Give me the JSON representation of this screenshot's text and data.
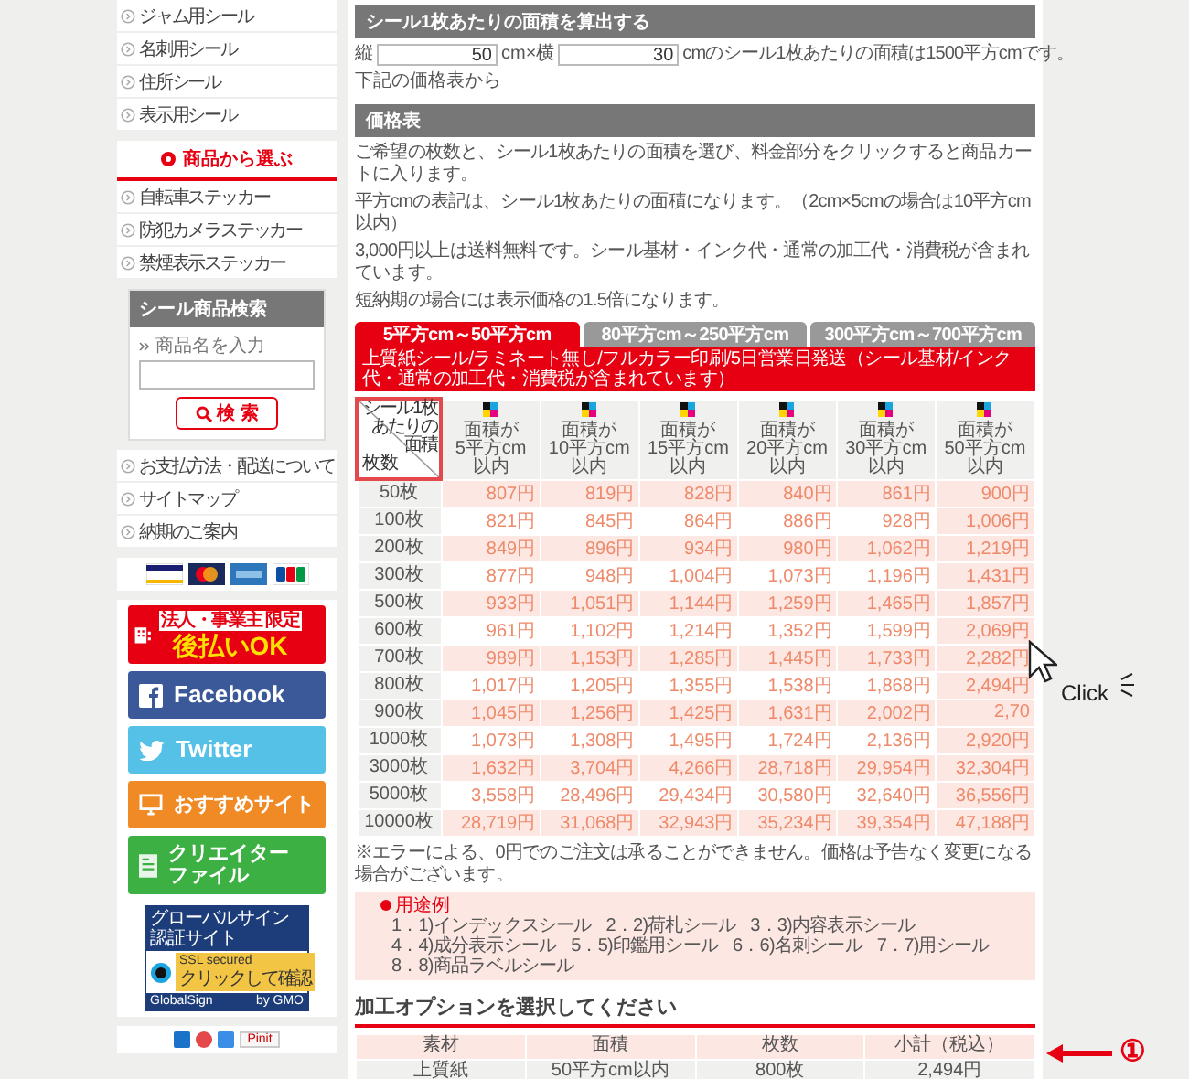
{
  "sidebar": {
    "top_items": [
      "ジャム用シール",
      "名刺用シール",
      "住所シール",
      "表示用シール"
    ],
    "category": {
      "title": "商品から選ぶ",
      "items": [
        "自転車ステッカー",
        "防犯カメラステッカー",
        "禁煙表示ステッカー"
      ]
    },
    "search": {
      "title": "シール商品検索",
      "hint": "商品名を入力",
      "button": "検 索"
    },
    "info_items": [
      "お支払方法・配送について",
      "サイトマップ",
      "納期のご案内"
    ],
    "banners": [
      {
        "kind": "atobarai",
        "tag": "法人・事業主 限定",
        "label": "後払いOK"
      },
      {
        "kind": "facebook",
        "label": "Facebook"
      },
      {
        "kind": "twitter",
        "label": "Twitter"
      },
      {
        "kind": "recommend",
        "label": "おすすめサイト"
      },
      {
        "kind": "creator",
        "lines": [
          "クリエイター",
          "ファイル"
        ]
      }
    ],
    "seal": {
      "title": "グローバルサイン認証サイト",
      "ssl": "SSL secured",
      "check": "クリックして確認",
      "brand": "GlobalSign",
      "by": "by GMO"
    },
    "share": {
      "pin": "Pinit"
    }
  },
  "calculator": {
    "title": "シール1枚あたりの面積を算出する",
    "height_label": "縦",
    "height_value": "50",
    "times_label": "cm×横",
    "width_value": "30",
    "result": "cmのシール1枚あたりの面積は1500平方cmです。",
    "next": "下記の価格表から"
  },
  "price_table": {
    "title": "価格表",
    "notes": [
      "ご希望の枚数と、シール1枚あたりの面積を選び、料金部分をクリックすると商品カートに入ります。",
      "平方cmの表記は、シール1枚あたりの面積になります。（2cm×5cmの場合は10平方cm以内）",
      "3,000円以上は送料無料です。シール基材・インク代・通常の加工代・消費税が含まれています。",
      "短納期の場合には表示価格の1.5倍になります。"
    ],
    "tabs": [
      {
        "label": "5平方cm～50平方cm",
        "selected": true
      },
      {
        "label": "80平方cm～250平方cm",
        "selected": false
      },
      {
        "label": "300平方cm～700平方cm",
        "selected": false
      }
    ],
    "banner": "上質紙シール/ラミネート無し/フルカラー印刷/5日営業日発送（シール基材/インク代・通常の加工代・消費税が含まれています）",
    "corner": {
      "area": "シール1枚あたりの面積",
      "qty": "枚数"
    },
    "columns": [
      {
        "lines": [
          "面積が",
          "5平方cm",
          "以内"
        ],
        "highlighted": false
      },
      {
        "lines": [
          "面積が",
          "10平方cm",
          "以内"
        ],
        "highlighted": false
      },
      {
        "lines": [
          "面積が",
          "15平方cm",
          "以内"
        ],
        "highlighted": false
      },
      {
        "lines": [
          "面積が",
          "20平方cm",
          "以内"
        ],
        "highlighted": false
      },
      {
        "lines": [
          "面積が",
          "30平方cm",
          "以内"
        ],
        "highlighted": false
      },
      {
        "lines": [
          "面積が",
          "50平方cm",
          "以内"
        ],
        "highlighted": true
      }
    ],
    "rows": [
      {
        "qty": "50枚",
        "prices": [
          "807円",
          "819円",
          "828円",
          "840円",
          "861円",
          "900円"
        ]
      },
      {
        "qty": "100枚",
        "prices": [
          "821円",
          "845円",
          "864円",
          "886円",
          "928円",
          "1,006円"
        ]
      },
      {
        "qty": "200枚",
        "prices": [
          "849円",
          "896円",
          "934円",
          "980円",
          "1,062円",
          "1,219円"
        ]
      },
      {
        "qty": "300枚",
        "prices": [
          "877円",
          "948円",
          "1,004円",
          "1,073円",
          "1,196円",
          "1,431円"
        ]
      },
      {
        "qty": "500枚",
        "prices": [
          "933円",
          "1,051円",
          "1,144円",
          "1,259円",
          "1,465円",
          "1,857円"
        ]
      },
      {
        "qty": "600枚",
        "prices": [
          "961円",
          "1,102円",
          "1,214円",
          "1,352円",
          "1,599円",
          "2,069円"
        ]
      },
      {
        "qty": "700枚",
        "prices": [
          "989円",
          "1,153円",
          "1,285円",
          "1,445円",
          "1,733円",
          "2,282円"
        ]
      },
      {
        "qty": "800枚",
        "prices": [
          "1,017円",
          "1,205円",
          "1,355円",
          "1,538円",
          "1,868円",
          "2,494円"
        ]
      },
      {
        "qty": "900枚",
        "prices": [
          "1,045円",
          "1,256円",
          "1,425円",
          "1,631円",
          "2,002円",
          "2,70"
        ]
      },
      {
        "qty": "1000枚",
        "prices": [
          "1,073円",
          "1,308円",
          "1,495円",
          "1,724円",
          "2,136円",
          "2,920円"
        ]
      },
      {
        "qty": "3000枚",
        "prices": [
          "1,632円",
          "3,704円",
          "4,266円",
          "28,718円",
          "29,954円",
          "32,304円"
        ]
      },
      {
        "qty": "5000枚",
        "prices": [
          "3,558円",
          "28,496円",
          "29,434円",
          "30,580円",
          "32,640円",
          "36,556円"
        ]
      },
      {
        "qty": "10000枚",
        "prices": [
          "28,719円",
          "31,068円",
          "32,943円",
          "35,234円",
          "39,354円",
          "47,188円"
        ]
      }
    ],
    "footnote": "※エラーによる、0円でのご注文は承ることができません。価格は予告なく変更になる場合がございます。"
  },
  "usage": {
    "title": "用途例",
    "items": [
      "1．1)インデックスシール",
      "2．2)荷札シール",
      "3．3)内容表示シール",
      "4．4)成分表示シール",
      "5．5)印鑑用シール",
      "6．6)名刺シール",
      "7．7)用シール",
      "8．8)商品ラベルシール"
    ]
  },
  "options": {
    "title": "加工オプションを選択してください",
    "columns": [
      "素材",
      "面積",
      "枚数",
      "小計（税込）"
    ],
    "row": [
      "上質紙",
      "50平方cm以内",
      "800枚",
      "2,494円"
    ]
  },
  "annotations": {
    "click": "Click",
    "marker": "①"
  }
}
